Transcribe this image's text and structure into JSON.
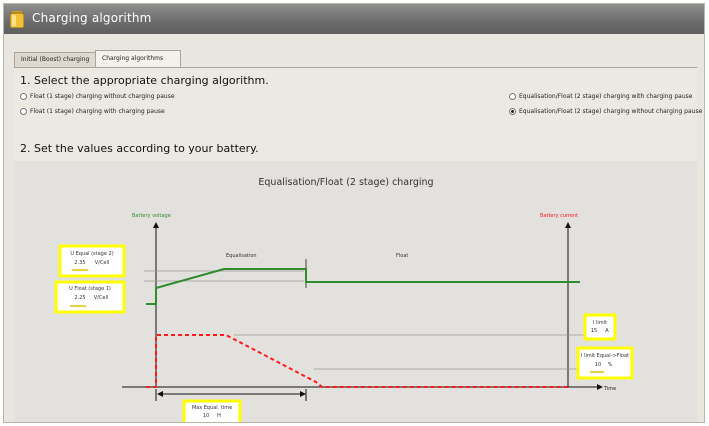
{
  "window": {
    "title": "Charging algorithm"
  },
  "tabs": [
    {
      "label": "Initial (Boost) charging",
      "active": false
    },
    {
      "label": "Charging algorithms",
      "active": true
    }
  ],
  "section1": {
    "heading": "1. Select the appropriate charging algorithm.",
    "options": [
      {
        "label": "Float (1 stage) charging without charging pause",
        "selected": false
      },
      {
        "label": "Float (1 stage) charging with charging pause",
        "selected": false
      },
      {
        "label": "Equalisation/Float (2 stage) charging with charging pause",
        "selected": false
      },
      {
        "label": "Equalisation/Float (2 stage) charging without charging pause",
        "selected": true
      }
    ]
  },
  "section2": {
    "heading": "2. Set the values according to your battery."
  },
  "diagram": {
    "title": "Equalisation/Float (2 stage) charging",
    "axis_voltage_label": "Battery voltage",
    "axis_current_label": "Battery current",
    "axis_time_label": "Time",
    "phase_equal_label": "Equalisation",
    "phase_float_label": "Float",
    "colors": {
      "voltage": "#2e8b2e",
      "current": "#ff1a1a",
      "highlight": "#ffff00"
    },
    "fields": {
      "u_equal": {
        "label": "U Equal (stage 2)",
        "value": "2.35",
        "unit": "V/Cell"
      },
      "u_float": {
        "label": "U Float (stage 1)",
        "value": "2.25",
        "unit": "V/Cell"
      },
      "i_limit": {
        "label": "I limit",
        "value": "15",
        "unit": "A"
      },
      "i_limit_equal_float": {
        "label": "I limit Equal->Float",
        "value": "10",
        "unit": "%"
      },
      "max_equal_time": {
        "label": "Max Equal. time",
        "value": "10",
        "unit": "H"
      }
    }
  }
}
